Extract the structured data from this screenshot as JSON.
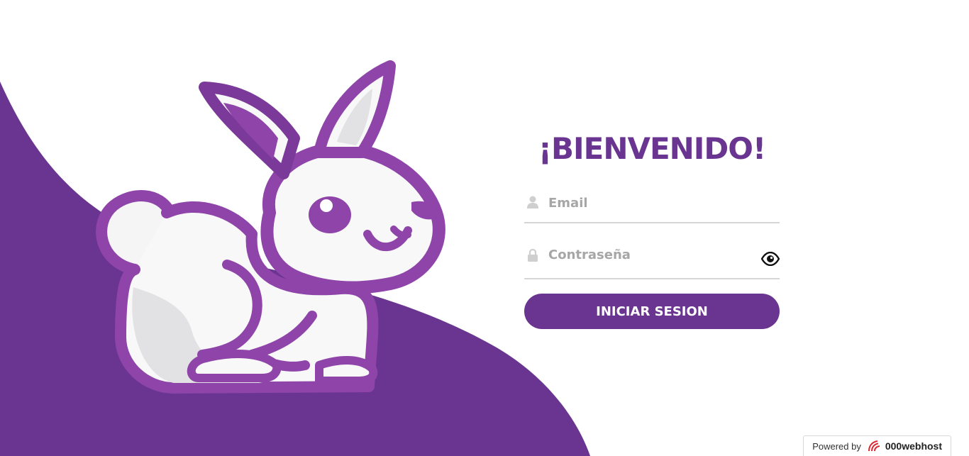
{
  "login": {
    "title": "¡BIENVENIDO!",
    "email_placeholder": "Email",
    "password_placeholder": "Contraseña",
    "submit_label": "INICIAR SESION"
  },
  "footer": {
    "powered_label": "Powered by",
    "host_name": "000webhost"
  },
  "colors": {
    "brand_purple": "#6a3590",
    "bunny_outline": "#8e44a8",
    "input_underline": "#d6d6d6",
    "placeholder_gray": "#a6a6a6"
  },
  "icons": {
    "email_field": "user-icon",
    "password_field": "lock-icon",
    "password_toggle": "eye-icon",
    "host_logo": "000webhost-logo-icon",
    "illustration": "bunny-logo"
  }
}
